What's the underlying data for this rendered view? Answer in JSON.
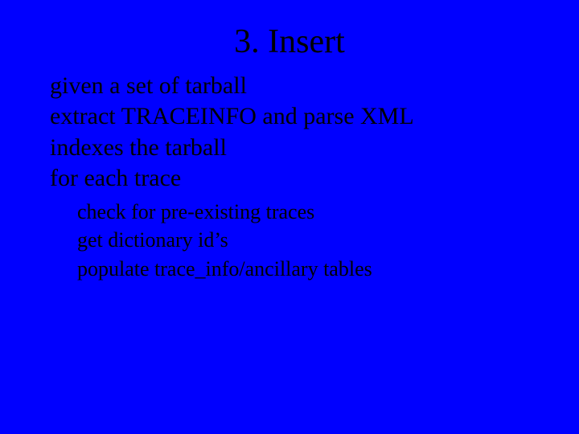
{
  "title": "3. Insert",
  "bullets": {
    "l1": {
      "b0": "given a set of tarball",
      "b1": "extract TRACEINFO and parse XML",
      "b2": "indexes the tarball",
      "b3": "for each trace"
    },
    "l2": {
      "s0": "check for pre-existing traces",
      "s1": "get dictionary id’s",
      "s2": "populate trace_info/ancillary tables"
    }
  }
}
